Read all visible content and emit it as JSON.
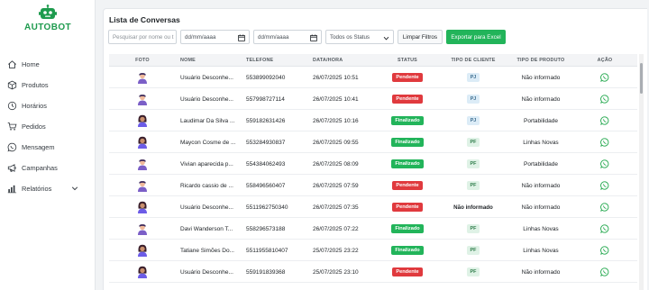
{
  "brand": {
    "name": "AUTOBOT",
    "icon": "robot-icon",
    "color": "#1e9b4e"
  },
  "sidebar": {
    "items": [
      {
        "label": "Home",
        "icon": "home-icon"
      },
      {
        "label": "Produtos",
        "icon": "box-icon"
      },
      {
        "label": "Horários",
        "icon": "clock-icon"
      },
      {
        "label": "Pedidos",
        "icon": "cart-icon"
      },
      {
        "label": "Mensagem",
        "icon": "whatsapp-icon"
      },
      {
        "label": "Campanhas",
        "icon": "megaphone-icon"
      },
      {
        "label": "Relatórios",
        "icon": "chart-icon",
        "has_submenu": true
      }
    ]
  },
  "main": {
    "title": "Lista de Conversas",
    "filters": {
      "search_placeholder": "Pesquisar por nome ou t",
      "date_from_placeholder": "dd/mm/aaaa",
      "date_to_placeholder": "dd/mm/aaaa",
      "status_selected": "Todos os Status",
      "clear_label": "Limpar Filtros",
      "export_label": "Exportar para Excel"
    },
    "table": {
      "headers": [
        "FOTO",
        "NOME",
        "TELEFONE",
        "DATA/HORA",
        "STATUS",
        "TIPO DE CLIENTE",
        "TIPO DE PRODUTO",
        "AÇÃO"
      ],
      "rows": [
        {
          "avatar": "male-avatar",
          "name": "Usuário Desconhe...",
          "phone": "553899092040",
          "datetime": "26/07/2025 10:51",
          "status": "Pendente",
          "client_type": "PJ",
          "product_type": "Não informado"
        },
        {
          "avatar": "male-avatar",
          "name": "Usuário Desconhe...",
          "phone": "557998727114",
          "datetime": "26/07/2025 10:41",
          "status": "Pendente",
          "client_type": "PJ",
          "product_type": "Não informado"
        },
        {
          "avatar": "female-avatar",
          "name": "Laudimar Da Silva ...",
          "phone": "559182631426",
          "datetime": "26/07/2025 10:16",
          "status": "Finalizado",
          "client_type": "PJ",
          "product_type": "Portabilidade"
        },
        {
          "avatar": "female-avatar",
          "name": "Maycon Cosme de ...",
          "phone": "553284930837",
          "datetime": "26/07/2025 09:55",
          "status": "Finalizado",
          "client_type": "PF",
          "product_type": "Linhas Novas"
        },
        {
          "avatar": "male-avatar",
          "name": "Vivian aparecida p...",
          "phone": "554384062493",
          "datetime": "26/07/2025 08:09",
          "status": "Finalizado",
          "client_type": "PF",
          "product_type": "Portabilidade"
        },
        {
          "avatar": "male-avatar",
          "name": "Ricardo cassio de ...",
          "phone": "558496560407",
          "datetime": "26/07/2025 07:59",
          "status": "Pendente",
          "client_type": "PF",
          "product_type": "Não informado"
        },
        {
          "avatar": "female-avatar",
          "name": "Usuário Desconhe...",
          "phone": "5511962750340",
          "datetime": "26/07/2025 07:35",
          "status": "Pendente",
          "client_type": "Não informado",
          "product_type": "Não informado"
        },
        {
          "avatar": "male-avatar",
          "name": "Davi Wanderson T...",
          "phone": "558296573188",
          "datetime": "26/07/2025 07:22",
          "status": "Finalizado",
          "client_type": "PF",
          "product_type": "Linhas Novas"
        },
        {
          "avatar": "female-avatar",
          "name": "Tatiane Simões Do...",
          "phone": "5511955810407",
          "datetime": "25/07/2025 23:22",
          "status": "Finalizado",
          "client_type": "PF",
          "product_type": "Linhas Novas"
        },
        {
          "avatar": "female-avatar",
          "name": "Usuário Desconhe...",
          "phone": "559191839368",
          "datetime": "25/07/2025 23:10",
          "status": "Pendente",
          "client_type": "PF",
          "product_type": "Não informado"
        }
      ]
    }
  },
  "colors": {
    "pending": "#e03a3e",
    "finished": "#22b45a",
    "whatsapp": "#25a94f",
    "export": "#22b45a"
  }
}
